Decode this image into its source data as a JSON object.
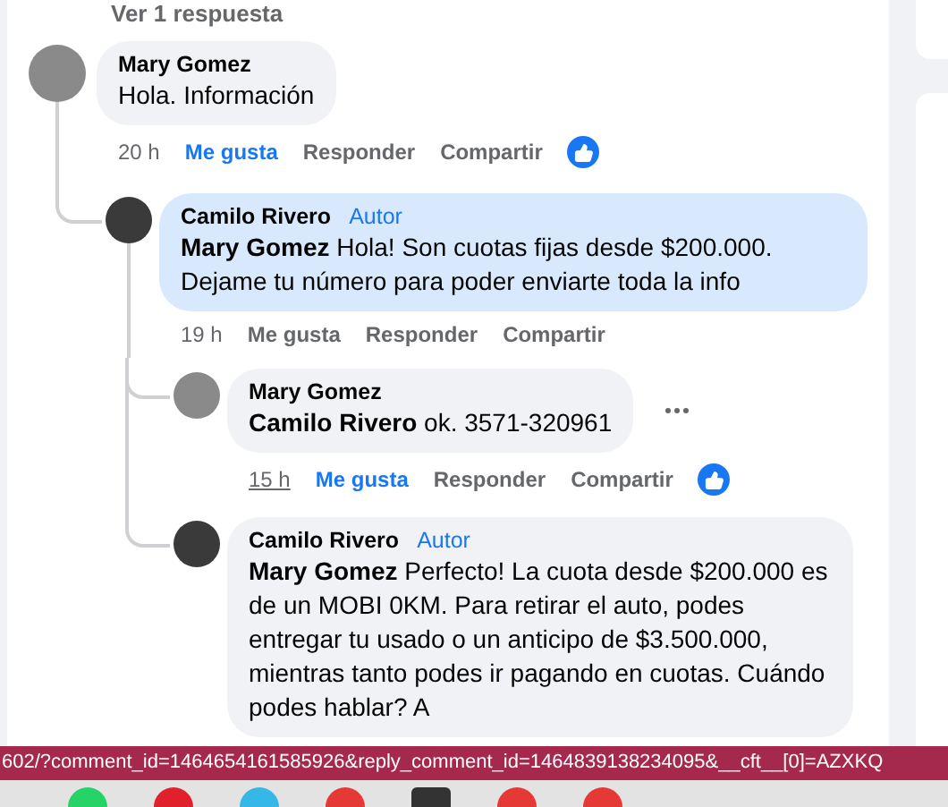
{
  "view_replies": "Ver 1 respuesta",
  "comments": [
    {
      "author": "Mary Gomez",
      "text": "Hola. Información",
      "time": "20 h",
      "time_hovered": false,
      "like_label": "Me gusta",
      "reply_label": "Responder",
      "share_label": "Compartir",
      "liked": true,
      "reacted": true,
      "replies": [
        {
          "author": "Camilo Rivero",
          "badge": "Autor",
          "text": "**Mary Gomez** Hola! Son cuotas fijas desde $200.000. Dejame tu número para poder enviarte toda la info",
          "time": "19 h",
          "time_hovered": false,
          "like_label": "Me gusta",
          "reply_label": "Responder",
          "share_label": "Compartir",
          "liked": false,
          "highlighted": true,
          "replies": [
            {
              "author": "Mary Gomez",
              "text": "**Camilo Rivero** ok. 3571-320961",
              "time": "15 h",
              "time_hovered": true,
              "like_label": "Me gusta",
              "reply_label": "Responder",
              "share_label": "Compartir",
              "liked": true,
              "reacted": true,
              "menu_visible": true
            },
            {
              "author": "Camilo Rivero",
              "badge": "Autor",
              "text": "**Mary Gomez** Perfecto! La cuota desde $200.000 es de un MOBI 0KM. Para retirar el auto, podes entregar tu usado o un anticipo de $3.500.000, mientras tanto podes ir pagando en cuotas. Cuándo podes hablar? A"
            }
          ]
        }
      ]
    }
  ],
  "status_url": "602/?comment_id=1464654161585926&reply_comment_id=1464839138234095&__cft__[0]=AZXKQ"
}
